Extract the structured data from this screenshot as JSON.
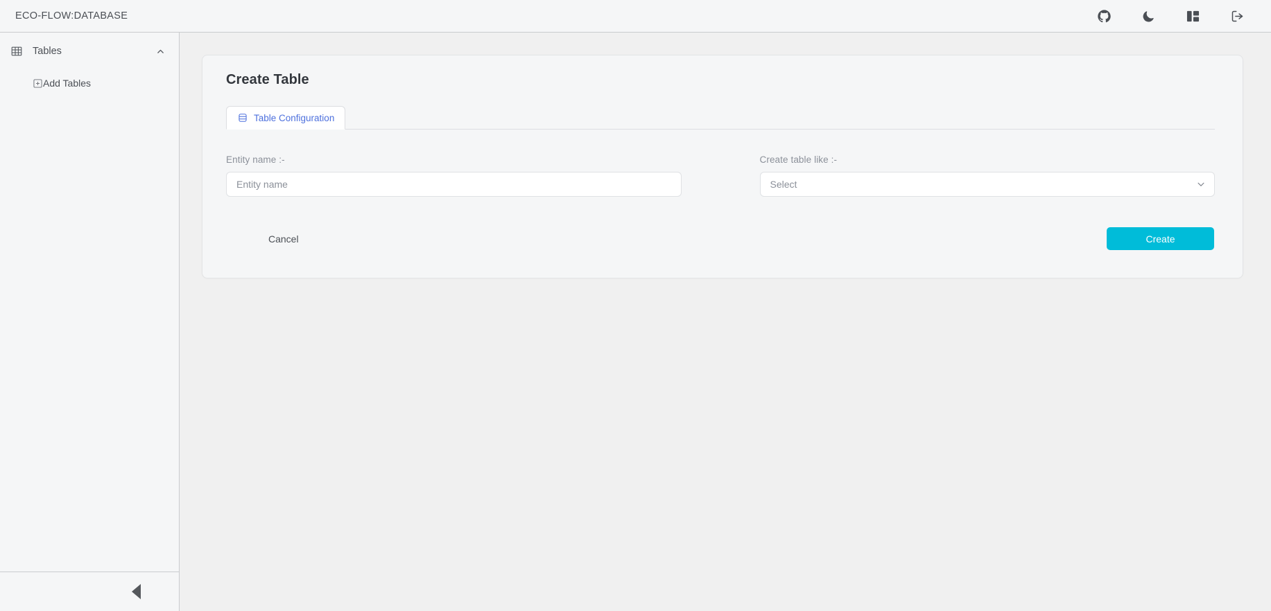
{
  "header": {
    "brand": "ECO-FLOW:DATABASE",
    "actions": [
      {
        "name": "github-icon",
        "label": "GitHub"
      },
      {
        "name": "moon-icon",
        "label": "Dark mode"
      },
      {
        "name": "layout-icon",
        "label": "Layout"
      },
      {
        "name": "logout-icon",
        "label": "Logout"
      }
    ]
  },
  "sidebar": {
    "group": {
      "icon": "table-icon",
      "label": "Tables",
      "chevron": "chevron-up-icon",
      "expanded": true
    },
    "items": [
      {
        "icon": "add-box-icon",
        "label": "Add Tables"
      }
    ],
    "collapse": {
      "icon": "caret-left-icon",
      "label": "Collapse sidebar"
    }
  },
  "main": {
    "card_title": "Create Table",
    "tabs": [
      {
        "icon": "database-icon",
        "label": "Table Configuration",
        "active": true
      }
    ],
    "form": {
      "entity_name": {
        "label": "Entity name :-",
        "placeholder": "Entity name",
        "value": ""
      },
      "create_table_like": {
        "label": "Create table like :-",
        "selected": "Select",
        "options": [
          "Select"
        ]
      }
    },
    "buttons": {
      "cancel": "Cancel",
      "create": "Create"
    }
  },
  "colors": {
    "accent": "#00bcd9",
    "tab_active_text": "#4d70dd",
    "panel_bg": "#f5f6f7",
    "page_bg": "#f0f0f0",
    "border": "#c9cbce"
  }
}
